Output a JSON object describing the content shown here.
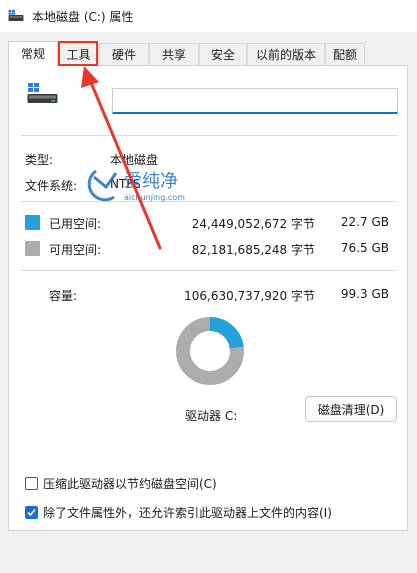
{
  "window": {
    "title": "本地磁盘 (C:) 属性"
  },
  "tabs": [
    {
      "label": "常规",
      "active": true
    },
    {
      "label": "工具"
    },
    {
      "label": "硬件"
    },
    {
      "label": "共享"
    },
    {
      "label": "安全"
    },
    {
      "label": "以前的版本"
    },
    {
      "label": "配额"
    }
  ],
  "general": {
    "drive_name_value": "",
    "type_label": "类型:",
    "type_value": "本地磁盘",
    "fs_label": "文件系统:",
    "fs_value": "NTFS",
    "used_label": "已用空间:",
    "used_bytes": "24,449,052,672 字节",
    "used_size": "22.7 GB",
    "free_label": "可用空间:",
    "free_bytes": "82,181,685,248 字节",
    "free_size": "76.5 GB",
    "capacity_label": "容量:",
    "capacity_bytes": "106,630,737,920 字节",
    "capacity_size": "99.3 GB",
    "drive_label": "驱动器 C:",
    "cleanup_button": "磁盘清理(D)",
    "compress_label": "压缩此驱动器以节约磁盘空间(C)",
    "compress_checked": false,
    "index_label": "除了文件属性外，还允许索引此驱动器上文件的内容(I)",
    "index_checked": true
  },
  "usage": {
    "used_fraction": 0.229,
    "used_color": "#26a0da",
    "free_color": "#acacac"
  },
  "watermark": {
    "logo_text": "爱纯净",
    "logo_url_text": "aichunjing.com"
  },
  "colors": {
    "accent": "#1a6fd0",
    "annotation": "#e8372c"
  }
}
